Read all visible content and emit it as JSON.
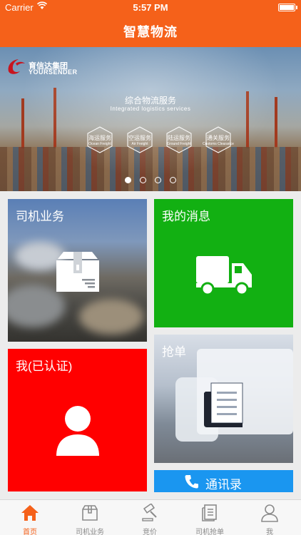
{
  "status_bar": {
    "carrier": "Carrier",
    "time": "5:57 PM"
  },
  "nav": {
    "title": "智慧物流"
  },
  "banner": {
    "logo_cn": "育信达集团",
    "logo_en": "YOURSENDER",
    "headline": "综合物流服务",
    "subheadline": "Integrated logistics services",
    "services": [
      {
        "cn": "海运服务",
        "en": "Ocean Freight"
      },
      {
        "cn": "空运服务",
        "en": "Air Freight"
      },
      {
        "cn": "陆运服务",
        "en": "Ground Freight"
      },
      {
        "cn": "通关服务",
        "en": "Customs Clearance"
      }
    ],
    "page_count": 4,
    "active_page": 1
  },
  "tiles": {
    "driver_business": "司机业务",
    "my_messages": "我的消息",
    "me_verified": "我(已认证)",
    "grab_order": "抢单",
    "contacts": "通讯录"
  },
  "tabbar": {
    "items": [
      {
        "label": "首页",
        "icon": "home-icon",
        "active": true
      },
      {
        "label": "司机业务",
        "icon": "package-icon",
        "active": false
      },
      {
        "label": "竞价",
        "icon": "gavel-icon",
        "active": false
      },
      {
        "label": "司机抢单",
        "icon": "document-icon",
        "active": false
      },
      {
        "label": "我",
        "icon": "person-icon",
        "active": false
      }
    ]
  },
  "colors": {
    "brand_orange": "#f5611a",
    "msg_green": "#12b012",
    "me_red": "#ff0000",
    "contacts_blue": "#1a96f0"
  }
}
